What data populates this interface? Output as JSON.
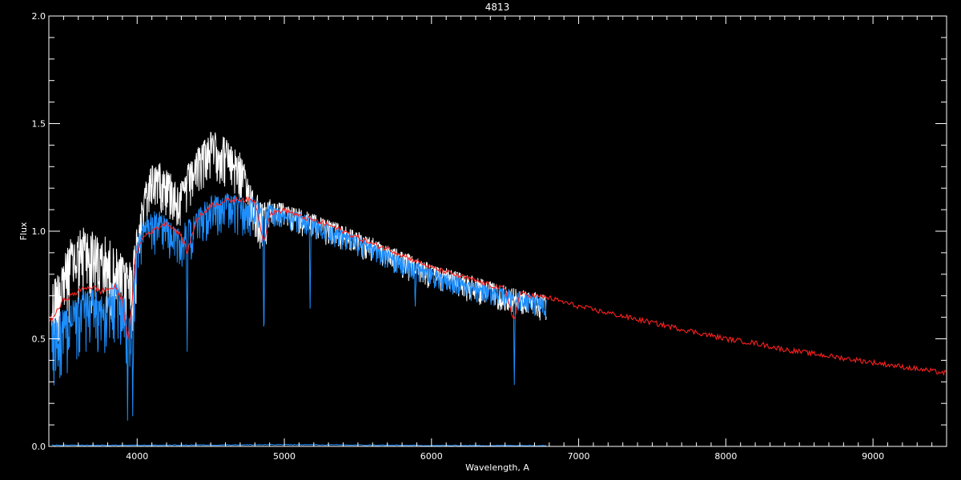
{
  "chart_data": {
    "type": "line",
    "title": "4813",
    "xlabel": "Wavelength, A",
    "ylabel": "Flux",
    "xlim": [
      3400,
      9500
    ],
    "ylim": [
      0.0,
      2.0
    ],
    "x_ticks": [
      {
        "value": 4000,
        "label": "4000"
      },
      {
        "value": 5000,
        "label": "5000"
      },
      {
        "value": 6000,
        "label": "6000"
      },
      {
        "value": 7000,
        "label": "7000"
      },
      {
        "value": 8000,
        "label": "8000"
      },
      {
        "value": 9000,
        "label": "9000"
      }
    ],
    "y_ticks": [
      {
        "value": 0.0,
        "label": "0.0"
      },
      {
        "value": 0.5,
        "label": "0.5"
      },
      {
        "value": 1.0,
        "label": "1.0"
      },
      {
        "value": 1.5,
        "label": "1.5"
      },
      {
        "value": 2.0,
        "label": "2.0"
      }
    ],
    "grid": false,
    "colors": {
      "background": "#000000",
      "axes": "#ffffff"
    },
    "series": [
      {
        "color": "#ffffff",
        "x": [
          3420,
          3450,
          3500,
          3550,
          3600,
          3650,
          3700,
          3750,
          3800,
          3850,
          3900,
          3950,
          3980,
          4000,
          4050,
          4100,
          4150,
          4200,
          4250,
          4300,
          4350,
          4400,
          4450,
          4500,
          4550,
          4600,
          4650,
          4700,
          4750,
          4800,
          4850,
          4900,
          4950,
          5000,
          5100,
          5200,
          5300,
          5400,
          5500,
          5600,
          5700,
          5800,
          5900,
          6000,
          6100,
          6200,
          6300,
          6400,
          6500,
          6600,
          6700,
          6780
        ],
        "y": [
          0.72,
          0.8,
          0.88,
          0.94,
          0.98,
          1.0,
          0.98,
          0.95,
          0.94,
          0.9,
          0.88,
          0.86,
          0.9,
          1.05,
          1.2,
          1.3,
          1.32,
          1.28,
          1.25,
          1.22,
          1.3,
          1.36,
          1.42,
          1.45,
          1.44,
          1.42,
          1.38,
          1.35,
          1.25,
          1.18,
          1.12,
          1.14,
          1.13,
          1.12,
          1.1,
          1.08,
          1.05,
          1.02,
          0.99,
          0.96,
          0.93,
          0.9,
          0.87,
          0.84,
          0.82,
          0.8,
          0.78,
          0.76,
          0.74,
          0.72,
          0.71,
          0.7
        ],
        "noise": 0.1
      },
      {
        "color": "#1e8fff",
        "x": [
          3420,
          3450,
          3500,
          3550,
          3600,
          3650,
          3700,
          3750,
          3800,
          3850,
          3900,
          3950,
          3980,
          4000,
          4050,
          4100,
          4150,
          4200,
          4250,
          4300,
          4350,
          4400,
          4450,
          4500,
          4550,
          4600,
          4650,
          4700,
          4750,
          4800,
          4850,
          4900,
          4950,
          5000,
          5100,
          5200,
          5300,
          5400,
          5500,
          5600,
          5700,
          5800,
          5900,
          6000,
          6100,
          6200,
          6300,
          6400,
          6500,
          6600,
          6700,
          6780
        ],
        "y": [
          0.55,
          0.6,
          0.62,
          0.66,
          0.7,
          0.72,
          0.72,
          0.7,
          0.72,
          0.74,
          0.72,
          0.62,
          0.78,
          0.95,
          1.05,
          1.08,
          1.08,
          1.06,
          1.02,
          1.0,
          1.05,
          1.08,
          1.12,
          1.15,
          1.17,
          1.17,
          1.16,
          1.15,
          1.14,
          1.15,
          1.1,
          1.12,
          1.11,
          1.1,
          1.08,
          1.06,
          1.03,
          1.0,
          0.97,
          0.94,
          0.91,
          0.88,
          0.85,
          0.82,
          0.8,
          0.78,
          0.76,
          0.74,
          0.73,
          0.71,
          0.7,
          0.69
        ],
        "noise": 0.08,
        "dips": [
          {
            "x": 3935,
            "y": 0.12
          },
          {
            "x": 3970,
            "y": 0.14
          },
          {
            "x": 4340,
            "y": 0.44
          },
          {
            "x": 4861,
            "y": 0.46
          },
          {
            "x": 5175,
            "y": 0.64
          },
          {
            "x": 5890,
            "y": 0.65
          },
          {
            "x": 6563,
            "y": 0.25
          }
        ]
      },
      {
        "color": "#ff2020",
        "x": [
          3400,
          3450,
          3500,
          3550,
          3600,
          3650,
          3700,
          3750,
          3800,
          3850,
          3900,
          3935,
          3960,
          3990,
          4050,
          4100,
          4200,
          4300,
          4340,
          4400,
          4500,
          4600,
          4700,
          4800,
          4861,
          4900,
          5000,
          5100,
          5200,
          5300,
          5400,
          5500,
          5600,
          5700,
          5800,
          5900,
          6000,
          6100,
          6200,
          6300,
          6400,
          6500,
          6563,
          6600,
          6700,
          6800,
          6900,
          7000,
          7200,
          7400,
          7600,
          7800,
          8000,
          8200,
          8400,
          8600,
          8800,
          9000,
          9200,
          9400,
          9500
        ],
        "y": [
          0.58,
          0.62,
          0.68,
          0.7,
          0.72,
          0.74,
          0.74,
          0.72,
          0.73,
          0.74,
          0.68,
          0.5,
          0.62,
          0.9,
          0.98,
          1.0,
          1.04,
          0.98,
          0.9,
          1.05,
          1.12,
          1.14,
          1.15,
          1.14,
          0.95,
          1.08,
          1.1,
          1.07,
          1.05,
          1.03,
          1.0,
          0.97,
          0.94,
          0.92,
          0.89,
          0.86,
          0.83,
          0.81,
          0.79,
          0.77,
          0.75,
          0.73,
          0.58,
          0.71,
          0.7,
          0.69,
          0.67,
          0.65,
          0.62,
          0.59,
          0.56,
          0.53,
          0.5,
          0.48,
          0.45,
          0.43,
          0.41,
          0.39,
          0.37,
          0.35,
          0.34
        ],
        "noise": 0.012
      },
      {
        "color": "#1e8fff",
        "x": [
          3420,
          4000,
          5000,
          5500,
          6000,
          6780
        ],
        "y": [
          0.005,
          0.005,
          0.008,
          0.006,
          0.004,
          0.004
        ],
        "noise": 0.002
      }
    ]
  }
}
